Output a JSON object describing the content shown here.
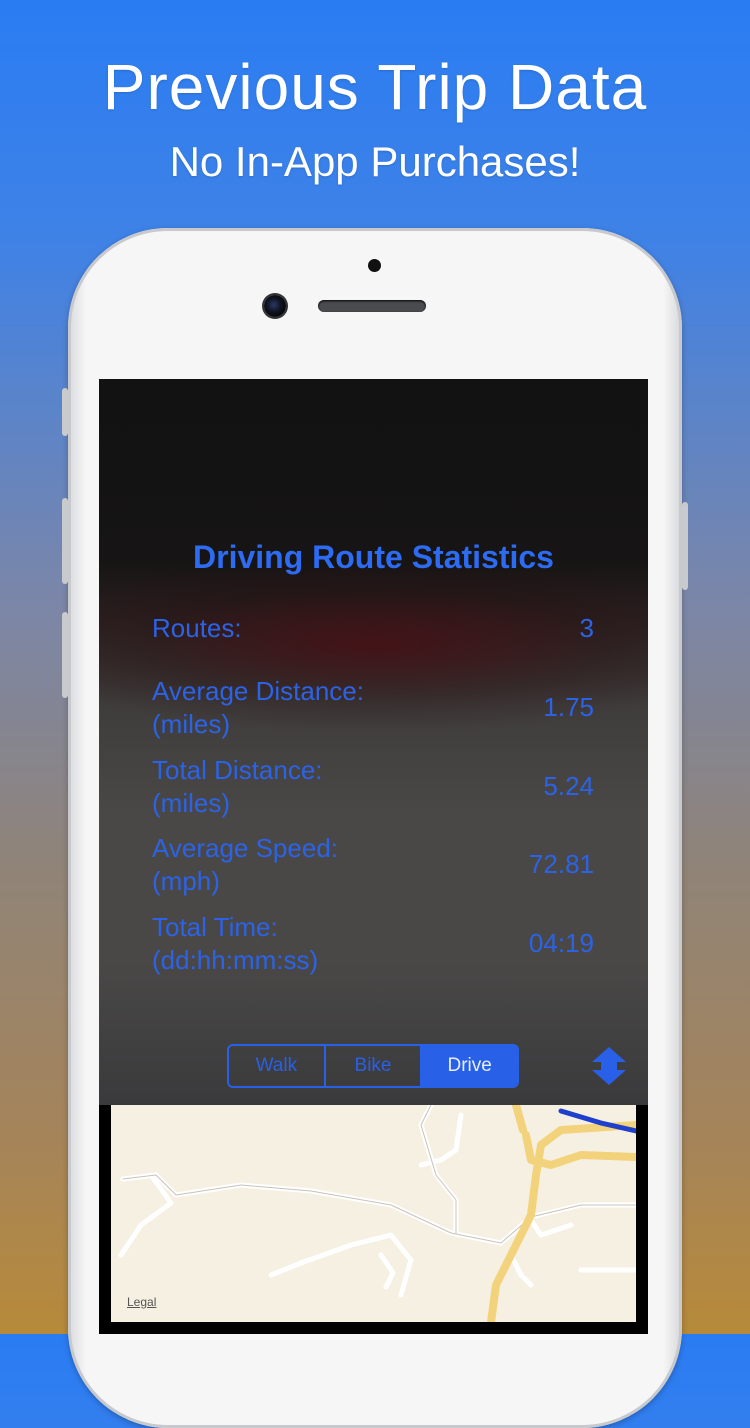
{
  "header": {
    "title": "Previous Trip Data",
    "subtitle": "No In-App Purchases!"
  },
  "stats": {
    "title": "Driving Route Statistics",
    "rows": [
      {
        "label": "Routes:",
        "unit": "",
        "value": "3"
      },
      {
        "label": "Average Distance:",
        "unit": "(miles)",
        "value": "1.75"
      },
      {
        "label": "Total Distance:",
        "unit": "(miles)",
        "value": "5.24"
      },
      {
        "label": "Average Speed:",
        "unit": "(mph)",
        "value": "72.81"
      },
      {
        "label": "Total Time:",
        "unit": "(dd:hh:mm:ss)",
        "value": "04:19"
      }
    ]
  },
  "mode_selector": {
    "options": [
      "Walk",
      "Bike",
      "Drive"
    ],
    "selected": "Drive"
  },
  "map": {
    "legal_label": "Legal"
  },
  "colors": {
    "accent": "#2860e8",
    "headline": "#ffffff"
  },
  "icons": {
    "toggle": "expand-collapse-icon"
  }
}
